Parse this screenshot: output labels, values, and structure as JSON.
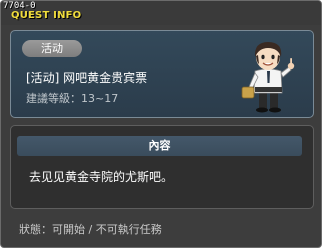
{
  "window": {
    "quest_id": "7704-0",
    "title": "QUEST INFO"
  },
  "quest": {
    "category_badge": "活动",
    "name": "[活动] 网吧黄金贵宾票",
    "level_requirement": "建議等級：13~17",
    "npc_icon": "npc-character-icon"
  },
  "content": {
    "header": "內容",
    "text": "去见见黄金寺院的尤斯吧。"
  },
  "footer": {
    "status": "狀態：可開始 / 不可執行任務"
  },
  "colors": {
    "title": "#f0dc3c",
    "background": "#3d3d3d",
    "panel": "#33495a"
  }
}
